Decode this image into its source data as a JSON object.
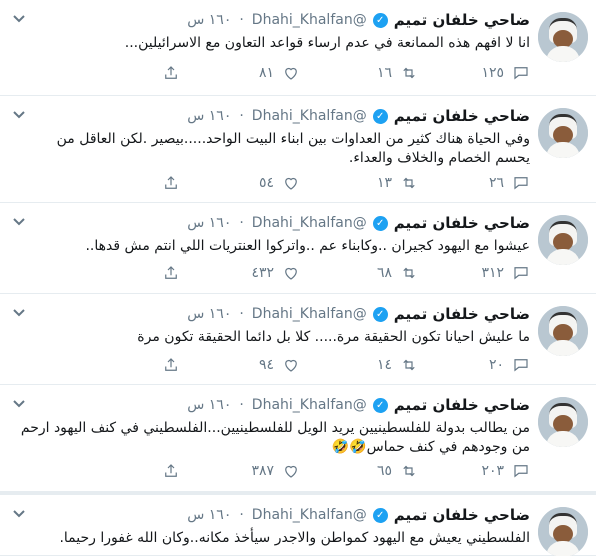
{
  "tweets": [
    {
      "name": "ضاحي خلفان تميم",
      "handle": "@Dhahi_Khalfan",
      "time": "١٦٠ س",
      "text": "انا لا افهم هذه الممانعة في عدم ارساء قواعد التعاون مع الاسرائيلين...",
      "replies": "١٢٥",
      "retweets": "١٦",
      "likes": "٨١"
    },
    {
      "name": "ضاحي خلفان تميم",
      "handle": "@Dhahi_Khalfan",
      "time": "١٦٠ س",
      "text": "وفي الحياة هناك كثير من العداوات بين ابناء البيت الواحد.....بيصير .لكن العاقل من يحسم الخصام والخلاف والعداء.",
      "replies": "٢٦",
      "retweets": "١٣",
      "likes": "٥٤"
    },
    {
      "name": "ضاحي خلفان تميم",
      "handle": "@Dhahi_Khalfan",
      "time": "١٦٠ س",
      "text": "عيشوا مع اليهود كجيران ..وكابناء عم ..واتركوا العنتريات اللي انتم مش قدها..",
      "replies": "٣١٢",
      "retweets": "٦٨",
      "likes": "٤٣٢"
    },
    {
      "name": "ضاحي خلفان تميم",
      "handle": "@Dhahi_Khalfan",
      "time": "١٦٠ س",
      "text": "ما عليش احيانا تكون الحقيقة مرة..... كلا بل دائما الحقيقة تكون مرة",
      "replies": "٢٠",
      "retweets": "١٤",
      "likes": "٩٤"
    },
    {
      "name": "ضاحي خلفان تميم",
      "handle": "@Dhahi_Khalfan",
      "time": "١٦٠ س",
      "text": "من يطالب بدولة للفلسطينيين يريد الويل للفلسطينيين...الفلسطيني في كنف اليهود ارحم من وجودهم في كنف حماس🤣🤣",
      "replies": "٢٠٣",
      "retweets": "٦٥",
      "likes": "٣٨٧"
    },
    {
      "name": "ضاحي خلفان تميم",
      "handle": "@Dhahi_Khalfan",
      "time": "١٦٠ س",
      "text": "الفلسطيني يعيش مع اليهود كمواطن والاجدر سيأخذ مكانه..وكان الله غفورا رحيما."
    }
  ],
  "icons": {
    "reply": "reply-icon",
    "retweet": "retweet-icon",
    "like": "heart-icon",
    "share": "share-icon",
    "verified": "verified-badge-icon",
    "caret": "chevron-down-icon"
  },
  "colors": {
    "accent": "#1da1f2",
    "text": "#14171a",
    "muted": "#657786",
    "divider": "#e6ecf0"
  }
}
